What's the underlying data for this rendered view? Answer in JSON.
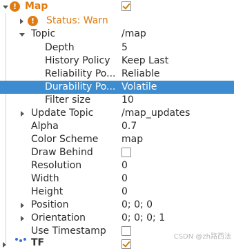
{
  "tree": {
    "map": {
      "label": "Map",
      "checked": true
    },
    "status": {
      "label": "Status: Warn"
    },
    "topic": {
      "label": "Topic",
      "value": "/map"
    },
    "depth": {
      "label": "Depth",
      "value": "5"
    },
    "history_policy": {
      "label": "History Policy",
      "value": "Keep Last"
    },
    "reliability_policy": {
      "label": "Reliability Po...",
      "value": "Reliable"
    },
    "durability_policy": {
      "label": "Durability Po...",
      "value": "Volatile"
    },
    "filter_size": {
      "label": "Filter size",
      "value": "10"
    },
    "update_topic": {
      "label": "Update Topic",
      "value": "/map_updates"
    },
    "alpha": {
      "label": "Alpha",
      "value": "0.7"
    },
    "color_scheme": {
      "label": "Color Scheme",
      "value": "map"
    },
    "draw_behind": {
      "label": "Draw Behind",
      "checked": false
    },
    "resolution": {
      "label": "Resolution",
      "value": "0"
    },
    "width": {
      "label": "Width",
      "value": "0"
    },
    "height": {
      "label": "Height",
      "value": "0"
    },
    "position": {
      "label": "Position",
      "value": "0; 0; 0"
    },
    "orientation": {
      "label": "Orientation",
      "value": "0; 0; 0; 1"
    },
    "use_timestamp": {
      "label": "Use Timestamp",
      "checked": false
    },
    "tf": {
      "label": "TF",
      "checked": true
    }
  },
  "warn_icon_glyph": "!",
  "colors": {
    "selection": "#3c8ccf",
    "warning": "#e07b10",
    "check": "#d08000"
  },
  "watermark": "CSDN @zh路西法"
}
